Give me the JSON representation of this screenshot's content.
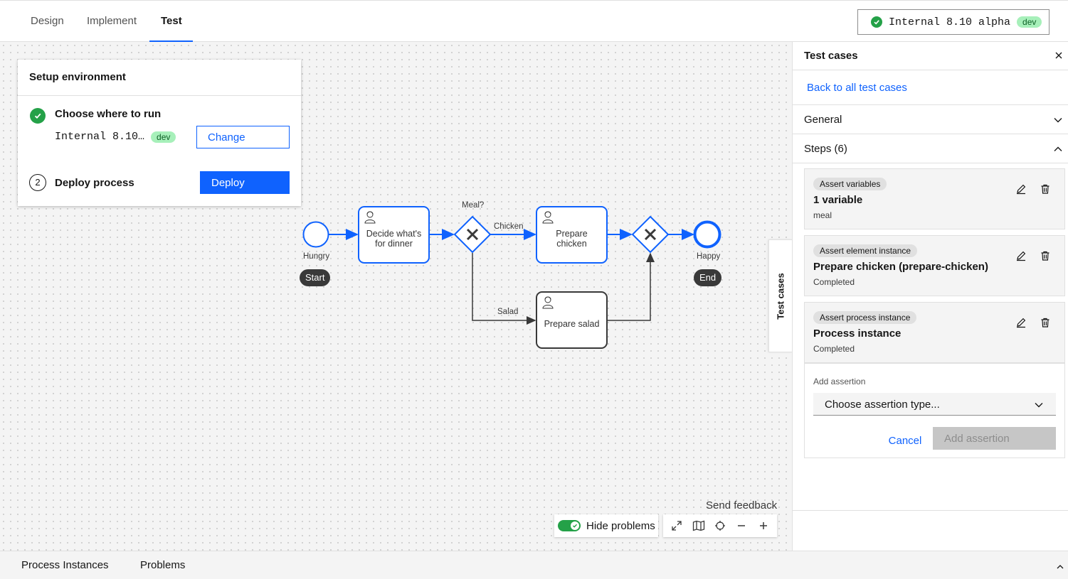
{
  "tabs": [
    {
      "label": "Design"
    },
    {
      "label": "Implement"
    },
    {
      "label": "Test"
    }
  ],
  "environment": {
    "name": "Internal 8.10 alpha",
    "badge": "dev"
  },
  "setup": {
    "title": "Setup environment",
    "step1_label": "Choose where to run",
    "env_short": "Internal 8.10…",
    "env_badge": "dev",
    "change_label": "Change",
    "step2_number": "2",
    "step2_label": "Deploy process",
    "deploy_label": "Deploy"
  },
  "diagram": {
    "start_event_label": "Hungry",
    "start_pill": "Start",
    "task_decide": "Decide what's for dinner",
    "gateway_label": "Meal?",
    "flow_chicken": "Chicken",
    "flow_salad": "Salad",
    "task_chicken": "Prepare chicken",
    "task_salad": "Prepare salad",
    "end_event_label": "Happy",
    "end_pill": "End"
  },
  "canvas_controls": {
    "send_feedback": "Send feedback",
    "hide_problems": "Hide problems",
    "side_tab": "Test cases"
  },
  "panel": {
    "title": "Test cases",
    "back_link": "Back to all test cases",
    "general_label": "General",
    "steps_label": "Steps (6)",
    "steps": [
      {
        "tag": "Assert variables",
        "title": "1 variable",
        "sub": "meal"
      },
      {
        "tag": "Assert element instance",
        "title": "Prepare chicken (prepare-chicken)",
        "sub": "Completed"
      },
      {
        "tag": "Assert process instance",
        "title": "Process instance",
        "sub": "Completed"
      }
    ],
    "add_assertion": {
      "label": "Add assertion",
      "select_value": "Choose assertion type...",
      "cancel_label": "Cancel",
      "add_label": "Add assertion"
    }
  },
  "bottom_tabs": [
    {
      "label": "Process Instances"
    },
    {
      "label": "Problems"
    }
  ],
  "colors": {
    "accent": "#0f62fe",
    "success": "#24a148",
    "dev_badge_bg": "#a7f0ba",
    "dev_badge_text": "#0e6027",
    "pill_bg": "#393939"
  }
}
